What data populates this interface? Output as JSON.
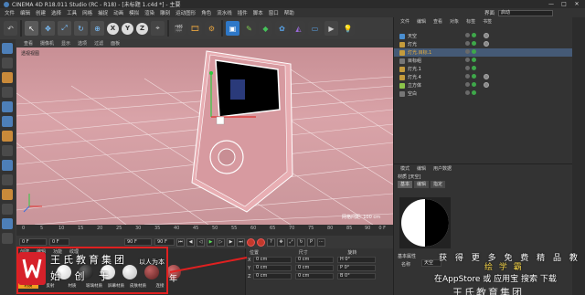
{
  "window": {
    "title": "CINEMA 4D R18.011 Studio (RC - R18) - [未标题 1.c4d *] - 主要",
    "controls": [
      "—",
      "□",
      "✕"
    ]
  },
  "menu": {
    "items": [
      "文件",
      "编辑",
      "创建",
      "选择",
      "工具",
      "网格",
      "捕捉",
      "动画",
      "模拟",
      "渲染",
      "雕刻",
      "运动图形",
      "角色",
      "流水线",
      "插件",
      "脚本",
      "窗口",
      "帮助"
    ]
  },
  "layout": {
    "label": "界面",
    "value": "启动"
  },
  "toolbar": {
    "axes": [
      "X",
      "Y",
      "Z"
    ]
  },
  "viewport": {
    "menu": [
      "查看",
      "摄像机",
      "显示",
      "选项",
      "过滤",
      "面板"
    ],
    "label": "透视视图",
    "grid_distance": "网格间距: 100 cm"
  },
  "timeline": {
    "ticks": [
      "0",
      "5",
      "10",
      "15",
      "20",
      "25",
      "30",
      "35",
      "40",
      "45",
      "50",
      "55",
      "60",
      "65",
      "70",
      "75",
      "80",
      "85",
      "90"
    ],
    "frame_end": "0 F",
    "start_field": "0 F",
    "current_field": "0 F",
    "end_field": "90 F",
    "max_field": "90 F"
  },
  "materials": {
    "tabs": [
      "创建",
      "编辑",
      "功能",
      "纹理"
    ],
    "swatches": [
      {
        "label": "材质",
        "color": "#f5f5f5",
        "active": true
      },
      {
        "label": "反射",
        "color": "#222222"
      },
      {
        "label": "材质",
        "color": "#e8e8e8"
      },
      {
        "label": "玻璃材质",
        "color": "#dcdcdc"
      },
      {
        "label": "屏幕材质",
        "color": "#8c3535"
      },
      {
        "label": "皮肤材质",
        "color": "#a33c3c"
      },
      {
        "label": "连接",
        "color": "#c24444"
      }
    ]
  },
  "coords": {
    "headers": [
      "位置",
      "尺寸",
      "旋转"
    ],
    "rows": [
      {
        "axis": "X",
        "pos": "0 cm",
        "size": "0 cm",
        "rot": "H 0°"
      },
      {
        "axis": "Y",
        "pos": "0 cm",
        "size": "0 cm",
        "rot": "P 0°"
      },
      {
        "axis": "Z",
        "pos": "0 cm",
        "size": "0 cm",
        "rot": "B 0°"
      }
    ]
  },
  "objects": {
    "menu": [
      "文件",
      "编辑",
      "查看",
      "对象",
      "标签",
      "书签"
    ],
    "items": [
      {
        "name": "天空",
        "icon": "sky",
        "highlight": false,
        "selected": false
      },
      {
        "name": "灯光",
        "icon": "light",
        "highlight": false,
        "selected": false
      },
      {
        "name": "灯光.目标.1",
        "icon": "light",
        "highlight": true,
        "selected": true
      },
      {
        "name": "目标组",
        "icon": "null",
        "highlight": false,
        "selected": false
      },
      {
        "name": "灯光.1",
        "icon": "light",
        "highlight": false,
        "selected": false
      },
      {
        "name": "灯光.4",
        "icon": "light",
        "highlight": false,
        "selected": false
      },
      {
        "name": "立方体",
        "icon": "cube",
        "highlight": false,
        "selected": false
      },
      {
        "name": "空白",
        "icon": "null",
        "highlight": false,
        "selected": false
      }
    ]
  },
  "attributes": {
    "menu": [
      "模式",
      "编辑",
      "用户数据"
    ],
    "header": "材质 [天空]",
    "tabs": [
      "基本",
      "编辑",
      "指定"
    ],
    "section": "基本属性",
    "field_label": "名称",
    "field_value": "天空"
  },
  "watermark": {
    "org": "王氏教育集团",
    "slogan_left": "始  创  于",
    "slogan_right": "以人为本",
    "year": "年",
    "right_line1": "获 得 更 多 免 费 精 品 教 程",
    "right_line2": "绘 学 霸",
    "right_line3": "在AppStore 或 应用宝 搜索 下载",
    "right_line4": "王氏教育集团"
  },
  "colors": {
    "viewport_bg": "#d29ca1",
    "accent": "#4a7fb8",
    "frame_red": "#e02020",
    "logo_red": "#d6212a"
  }
}
